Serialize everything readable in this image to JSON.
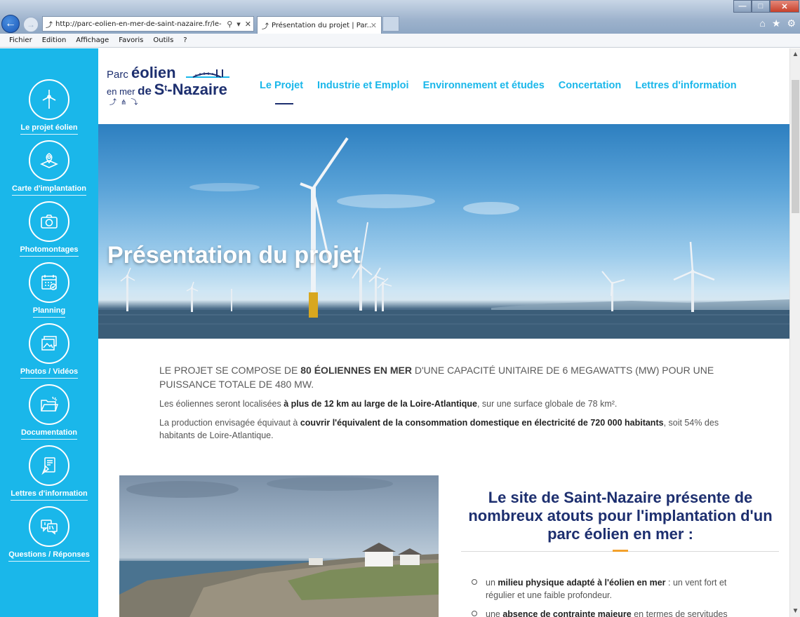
{
  "browser": {
    "url": "http://parc-eolien-en-mer-de-saint-nazaire.fr/le-",
    "tab_title": "Présentation du projet | Par...",
    "menu": [
      "Fichier",
      "Edition",
      "Affichage",
      "Favoris",
      "Outils",
      "?"
    ]
  },
  "logo": {
    "parc": "Parc",
    "eolien": "éolien",
    "en_mer": "en mer",
    "de": "de",
    "nazaire": "S",
    "nazaire_sup": "t",
    "nazaire_rest": "-Nazaire"
  },
  "nav": {
    "items": [
      "Le Projet",
      "Industrie et Emploi",
      "Environnement et études",
      "Concertation",
      "Lettres d'information"
    ],
    "active": "Le Projet"
  },
  "sidebar": {
    "items": [
      {
        "label": "Le projet éolien",
        "icon": "wind-turbine-icon"
      },
      {
        "label": "Carte d'implantation",
        "icon": "map-pin-icon"
      },
      {
        "label": "Photomontages",
        "icon": "camera-icon"
      },
      {
        "label": "Planning",
        "icon": "calendar-icon"
      },
      {
        "label": "Photos / Vidéos",
        "icon": "photos-icon"
      },
      {
        "label": "Documentation",
        "icon": "folder-icon"
      },
      {
        "label": "Lettres d'information",
        "icon": "newsletter-icon"
      },
      {
        "label": "Questions / Réponses",
        "icon": "chat-bubbles-icon"
      }
    ]
  },
  "hero": {
    "title": "Présentation du projet"
  },
  "intro": {
    "lead_1": "Le projet se compose de ",
    "lead_bold": "80 éoliennes en mer",
    "lead_2": " d'une capacité unitaire de 6 megawatts (MW) pour une puissance totale de 480 MW.",
    "p1_1": "Les éoliennes seront localisées ",
    "p1_bold": "à plus de 12 km au large de la Loire-Atlantique",
    "p1_2": ", sur une surface globale de 78 km².",
    "p2_1": "La production envisagée équivaut à ",
    "p2_bold": "couvrir l'équivalent de la consommation domestique en électricité de 720 000 habitants",
    "p2_2": ", soit 54% des habitants de Loire-Atlantique."
  },
  "atouts": {
    "title": "Le site de Saint-Nazaire présente de nombreux atouts pour l'implantation d'un parc éolien en mer :",
    "items": [
      {
        "pre": "un ",
        "bold": "milieu physique adapté à l'éolien en mer",
        "post": " : un vent fort et régulier et une faible profondeur."
      },
      {
        "pre": "une ",
        "bold": "absence de contrainte majeure",
        "post": " en termes de servitudes"
      }
    ]
  },
  "colors": {
    "sidebar": "#1ab7ea",
    "nav_text": "#1ab7ea",
    "heading": "#1d2f6f",
    "accent": "#f3a12c"
  }
}
